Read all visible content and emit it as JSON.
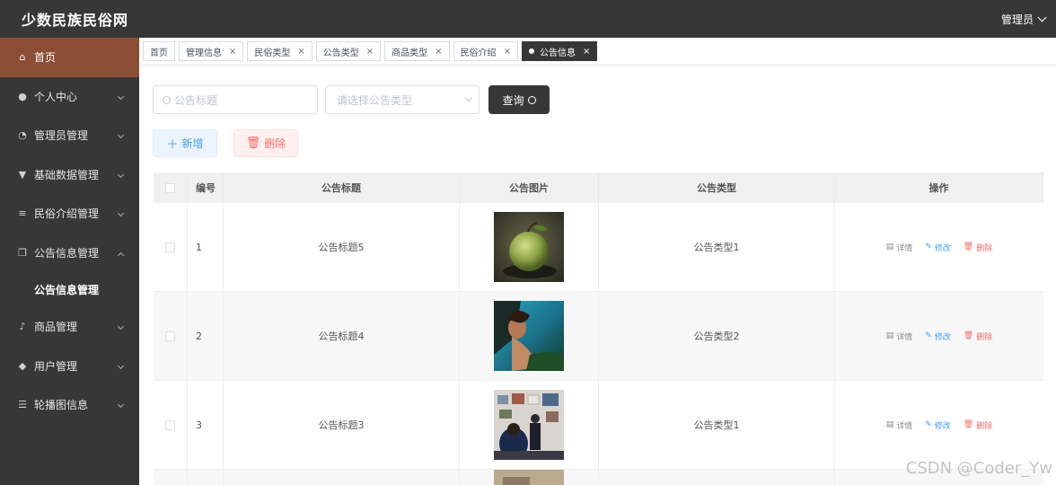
{
  "header": {
    "title": "少数民族民俗网",
    "user": "管理员"
  },
  "sidebar": {
    "items": [
      {
        "label": "首页",
        "icon": "home-icon",
        "glyph": "⌂"
      },
      {
        "label": "个人中心",
        "icon": "user-icon",
        "glyph": "●"
      },
      {
        "label": "管理员管理",
        "icon": "gauge-icon",
        "glyph": "◔"
      },
      {
        "label": "基础数据管理",
        "icon": "brush-icon",
        "glyph": "▼"
      },
      {
        "label": "民俗介绍管理",
        "icon": "list-icon",
        "glyph": "≡"
      },
      {
        "label": "公告信息管理",
        "icon": "copy-icon",
        "glyph": "❐"
      },
      {
        "label": "商品管理",
        "icon": "mic-icon",
        "glyph": "♪"
      },
      {
        "label": "用户管理",
        "icon": "location-icon",
        "glyph": "◆"
      },
      {
        "label": "轮播图信息",
        "icon": "menu-icon",
        "glyph": "☰"
      }
    ],
    "sub_active": "公告信息管理"
  },
  "tabs": [
    "首页",
    "管理信息",
    "民俗类型",
    "公告类型",
    "商品类型",
    "民俗介绍",
    "公告信息"
  ],
  "search": {
    "title_placeholder": "公告标题",
    "type_placeholder": "请选择公告类型",
    "query_label": "查询"
  },
  "actions": {
    "add_label": "新增",
    "delete_label": "删除"
  },
  "table": {
    "headers": [
      "编号",
      "公告标题",
      "公告图片",
      "公告类型",
      "操作"
    ],
    "rows": [
      {
        "id": "1",
        "title": "公告标题5",
        "type": "公告类型1"
      },
      {
        "id": "2",
        "title": "公告标题4",
        "type": "公告类型2"
      },
      {
        "id": "3",
        "title": "公告标题3",
        "type": "公告类型1"
      }
    ],
    "op_detail": "详情",
    "op_edit": "修改",
    "op_delete": "删除"
  },
  "watermark": "CSDN @Coder_Yw"
}
